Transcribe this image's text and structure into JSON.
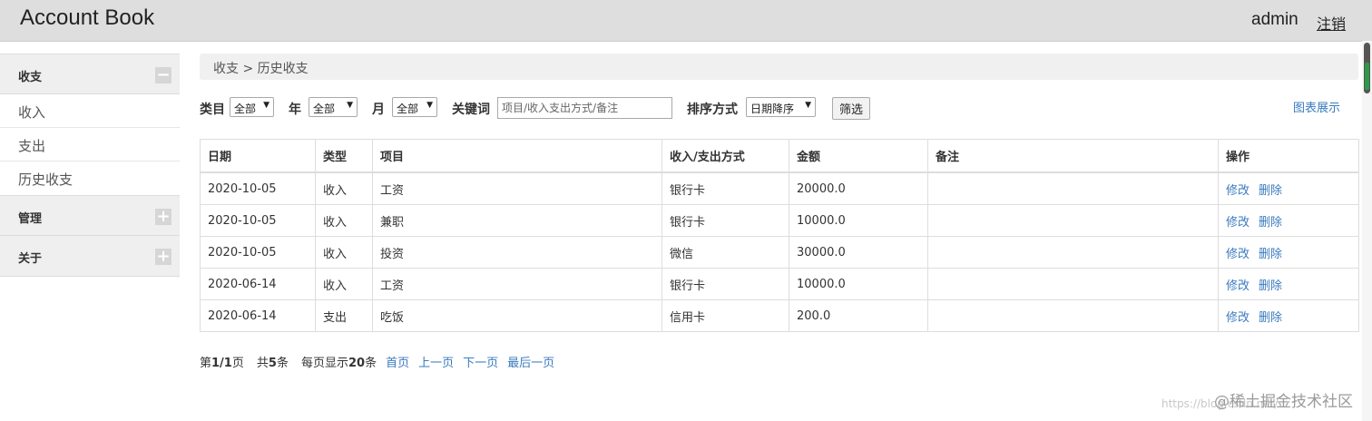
{
  "header": {
    "brand": "Account Book",
    "user": "admin",
    "logout": "注销"
  },
  "sidebar": {
    "groups": [
      {
        "title": "收支",
        "toggle": "−",
        "items": [
          "收入",
          "支出",
          "历史收支"
        ]
      },
      {
        "title": "管理",
        "toggle": "+",
        "items": []
      },
      {
        "title": "关于",
        "toggle": "+",
        "items": []
      }
    ]
  },
  "breadcrumb": "收支 > 历史收支",
  "filters": {
    "category_label": "类目",
    "category_value": "全部",
    "year_label": "年",
    "year_value": "全部",
    "month_label": "月",
    "month_value": "全部",
    "keyword_label": "关键词",
    "keyword_placeholder": "项目/收入支出方式/备注",
    "sort_label": "排序方式",
    "sort_value": "日期降序",
    "submit": "筛选",
    "chart_link": "图表展示"
  },
  "table": {
    "columns": [
      "日期",
      "类型",
      "项目",
      "收入/支出方式",
      "金额",
      "备注",
      "操作"
    ],
    "rows": [
      {
        "date": "2020-10-05",
        "type": "收入",
        "item": "工资",
        "method": "银行卡",
        "amount": "20000.0",
        "note": "",
        "edit": "修改",
        "delete": "删除"
      },
      {
        "date": "2020-10-05",
        "type": "收入",
        "item": "兼职",
        "method": "银行卡",
        "amount": "10000.0",
        "note": "",
        "edit": "修改",
        "delete": "删除"
      },
      {
        "date": "2020-10-05",
        "type": "收入",
        "item": "投资",
        "method": "微信",
        "amount": "30000.0",
        "note": "",
        "edit": "修改",
        "delete": "删除"
      },
      {
        "date": "2020-06-14",
        "type": "收入",
        "item": "工资",
        "method": "银行卡",
        "amount": "10000.0",
        "note": "",
        "edit": "修改",
        "delete": "删除"
      },
      {
        "date": "2020-06-14",
        "type": "支出",
        "item": "吃饭",
        "method": "信用卡",
        "amount": "200.0",
        "note": "",
        "edit": "修改",
        "delete": "删除"
      }
    ]
  },
  "pager": {
    "p1": "第",
    "page": "1/1",
    "p2": "页",
    "t1": "共",
    "total": "5",
    "t2": "条",
    "s1": "每页显示",
    "size": "20",
    "s2": "条",
    "first": "首页",
    "prev": "上一页",
    "next": "下一页",
    "last": "最后一页"
  },
  "watermark": {
    "url": "https://blog.csdn.net/...",
    "text": "@稀土掘金技术社区"
  }
}
